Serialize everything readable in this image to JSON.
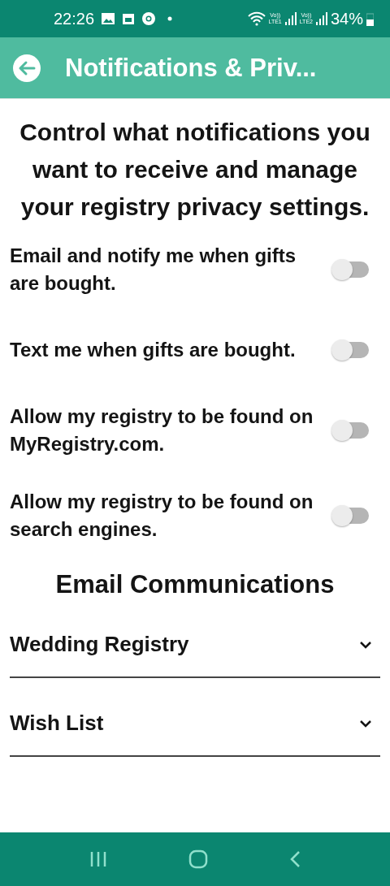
{
  "status_bar": {
    "time": "22:26",
    "sims": [
      {
        "top": "Vo))",
        "bottom": "LTE1"
      },
      {
        "top": "Vo))",
        "bottom": "LTE2"
      }
    ],
    "battery": "34%"
  },
  "app_bar": {
    "title": "Notifications & Priv..."
  },
  "intro": "Control what notifications you want to receive and manage your registry privacy settings.",
  "settings": [
    {
      "label": "Email and notify me when gifts are bought.",
      "on": false
    },
    {
      "label": "Text me when gifts are bought.",
      "on": false
    },
    {
      "label": "Allow my registry to be found on MyRegistry.com.",
      "on": false
    },
    {
      "label": "Allow my registry to be found on search engines.",
      "on": false
    }
  ],
  "email_section": {
    "title": "Email Communications",
    "items": [
      {
        "label": "Wedding Registry",
        "expanded": false
      },
      {
        "label": "Wish List",
        "expanded": false
      }
    ]
  }
}
